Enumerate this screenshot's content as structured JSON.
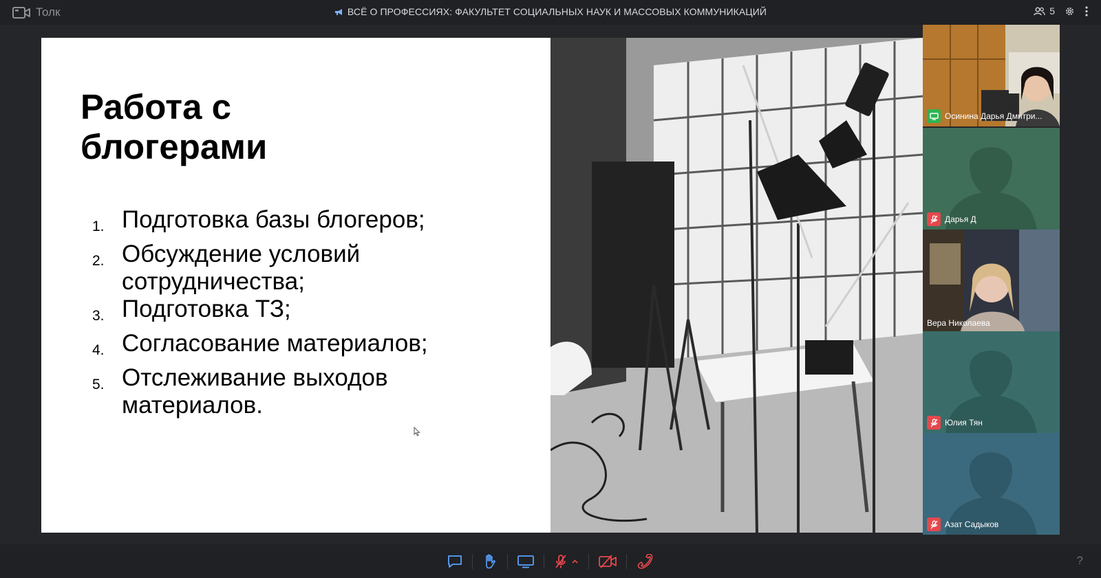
{
  "app": {
    "name": "Толк",
    "icon": "video-camera-icon"
  },
  "header": {
    "title": "ВСЁ О ПРОФЕССИЯХ: ФАКУЛЬТЕТ СОЦИАЛЬНЫХ НАУК И МАССОВЫХ КОММУНИКАЦИЙ",
    "title_icon": "megaphone-icon",
    "participants_count": "5"
  },
  "slide": {
    "title_line1": "Работа с",
    "title_line2": "блогерами",
    "items": [
      {
        "num": "1.",
        "lines": [
          "Подготовка базы блогеров;"
        ]
      },
      {
        "num": "2.",
        "lines": [
          "Обсуждение условий",
          "сотрудничества;"
        ]
      },
      {
        "num": "3.",
        "lines": [
          "Подготовка ТЗ;"
        ]
      },
      {
        "num": "4.",
        "lines": [
          "Согласование материалов;"
        ]
      },
      {
        "num": "5.",
        "lines": [
          "Отслеживание выходов",
          "материалов."
        ]
      }
    ]
  },
  "participants": [
    {
      "name": "Осинина Дарья Дмитри...",
      "status": "screen-sharing",
      "video": true
    },
    {
      "name": "Дарья Д",
      "status": "muted",
      "video": false
    },
    {
      "name": "Вера Николаева",
      "status": "speaking",
      "video": true
    },
    {
      "name": "Юлия Тян",
      "status": "muted",
      "video": false
    },
    {
      "name": "Азат Садыков",
      "status": "muted",
      "video": false
    }
  ],
  "controls": [
    "chat-icon",
    "raise-hand-icon",
    "screen-share-icon",
    "mic-off-icon",
    "chevron-up-icon",
    "camera-off-icon",
    "hang-up-icon"
  ],
  "help": "?",
  "colors": {
    "accent": "#2f80ff",
    "muted_red": "#e5484d",
    "tile_green": "#3f6f58",
    "tile_teal": "#3a6d6a",
    "tile_blue": "#3b6a7e",
    "screen_share_green": "#2fb452"
  }
}
